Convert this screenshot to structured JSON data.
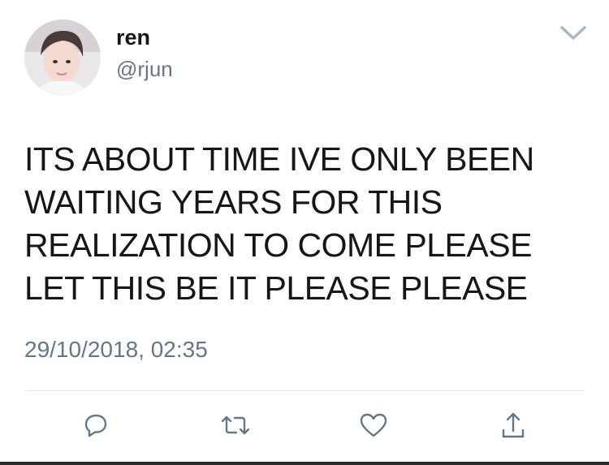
{
  "user": {
    "display_name": "ren",
    "handle": "@rjun"
  },
  "tweet": {
    "text": "ITS ABOUT TIME IVE ONLY BEEN\nWAITING YEARS FOR THIS\nREALIZATION TO COME PLEASE\nLET THIS BE IT PLEASE PLEASE",
    "timestamp": "29/10/2018, 02:35"
  },
  "actions": [
    "reply-icon",
    "retweet-icon",
    "like-icon",
    "share-icon"
  ],
  "colors": {
    "text": "#14171a",
    "secondary": "#657786",
    "divider": "#e1e8ed",
    "icon": "#657786"
  }
}
